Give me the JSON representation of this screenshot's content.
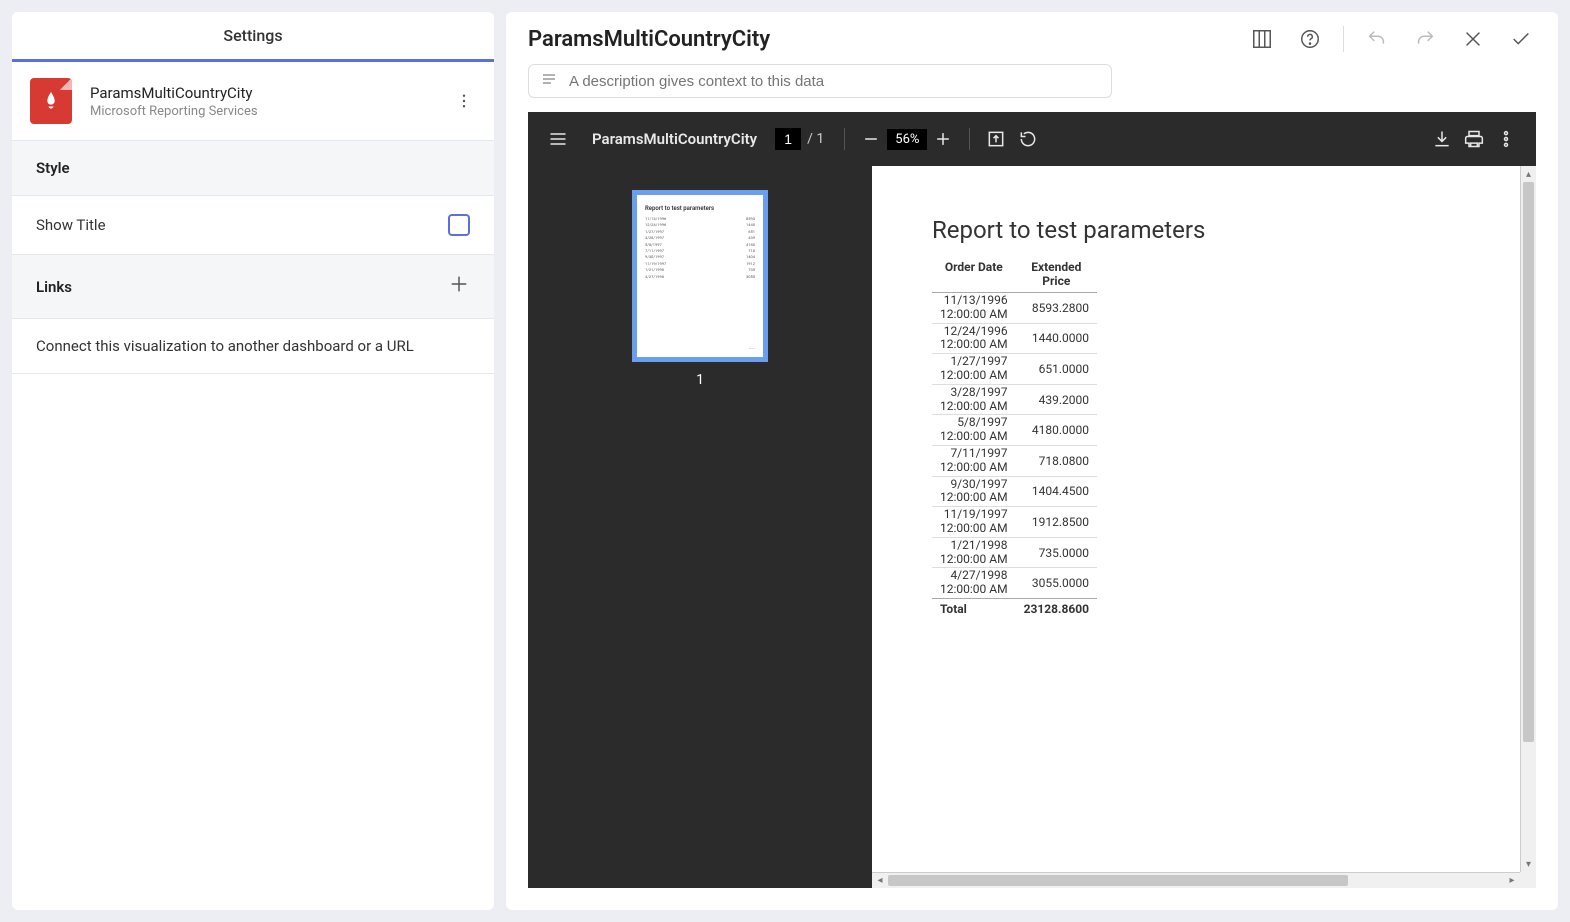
{
  "sidebar": {
    "header": "Settings",
    "report": {
      "title": "ParamsMultiCountryCity",
      "subtitle": "Microsoft Reporting Services"
    },
    "style_header": "Style",
    "show_title_label": "Show Title",
    "links_header": "Links",
    "links_help": "Connect this visualization to another dashboard or a URL"
  },
  "header": {
    "title": "ParamsMultiCountryCity",
    "desc_placeholder": "A description gives context to this data"
  },
  "viewer": {
    "title": "ParamsMultiCountryCity",
    "page_current": "1",
    "page_total": "1",
    "zoom": "56%",
    "thumb_label": "1"
  },
  "report": {
    "title": "Report to test parameters",
    "col_date": "Order Date",
    "col_price_1": "Extended",
    "col_price_2": "Price",
    "rows": [
      {
        "d1": "11/13/1996",
        "d2": "12:00:00 AM",
        "price": "8593.2800"
      },
      {
        "d1": "12/24/1996",
        "d2": "12:00:00 AM",
        "price": "1440.0000"
      },
      {
        "d1": "1/27/1997",
        "d2": "12:00:00 AM",
        "price": "651.0000"
      },
      {
        "d1": "3/28/1997",
        "d2": "12:00:00 AM",
        "price": "439.2000"
      },
      {
        "d1": "5/8/1997",
        "d2": "12:00:00 AM",
        "price": "4180.0000"
      },
      {
        "d1": "7/11/1997",
        "d2": "12:00:00 AM",
        "price": "718.0800"
      },
      {
        "d1": "9/30/1997",
        "d2": "12:00:00 AM",
        "price": "1404.4500"
      },
      {
        "d1": "11/19/1997",
        "d2": "12:00:00 AM",
        "price": "1912.8500"
      },
      {
        "d1": "1/21/1998",
        "d2": "12:00:00 AM",
        "price": "735.0000"
      },
      {
        "d1": "4/27/1998",
        "d2": "12:00:00 AM",
        "price": "3055.0000"
      }
    ],
    "total_label": "Total",
    "total_value": "23128.8600"
  }
}
